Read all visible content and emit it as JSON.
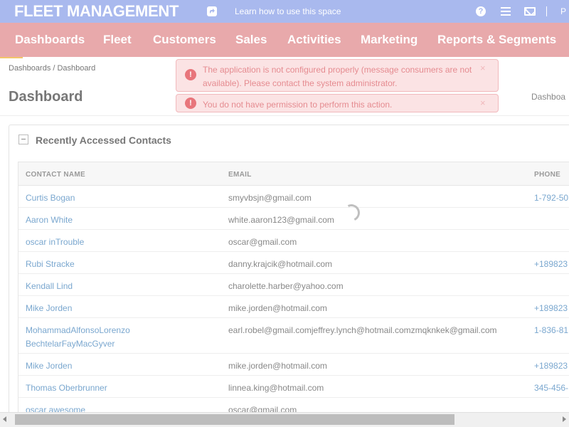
{
  "topbar": {
    "brand": "FLEET MANAGEMENT",
    "learn_link": "Learn how to use this space",
    "help_glyph": "?",
    "user_initial": "P"
  },
  "nav": {
    "items": [
      "Dashboards",
      "Fleet",
      "Customers",
      "Sales",
      "Activities",
      "Marketing",
      "Reports & Segments"
    ]
  },
  "breadcrumb": "Dashboards / Dashboard",
  "page_title": "Dashboard",
  "right_crumb": "Dashboa",
  "alerts": [
    {
      "icon": "!",
      "text": "The application is not configured properly (message consumers are not available). Please contact the system administrator.",
      "close": "×"
    },
    {
      "icon": "!",
      "text": "You do not have permission to perform this action.",
      "close": "×"
    }
  ],
  "widget": {
    "title": "Recently Accessed Contacts",
    "columns": [
      "CONTACT NAME",
      "EMAIL",
      "PHONE"
    ],
    "rows": [
      {
        "name": "Curtis Bogan",
        "email": "smyvbsjn@gmail.com",
        "phone": "1-792-50"
      },
      {
        "name": "Aaron White",
        "email": "white.aaron123@gmail.com",
        "phone": ""
      },
      {
        "name": "oscar inTrouble",
        "email": "oscar@gmail.com",
        "phone": ""
      },
      {
        "name": "Rubi Stracke",
        "email": "danny.krajcik@hotmail.com",
        "phone": "+189823"
      },
      {
        "name": "Kendall Lind",
        "email": "charolette.harber@yahoo.com",
        "phone": ""
      },
      {
        "name": "Mike Jorden",
        "email": "mike.jorden@hotmail.com",
        "phone": "+189823"
      },
      {
        "name": "MohammadAlfonsoLorenzo",
        "name_line2": "BechtelarFayMacGyver",
        "email": "earl.robel@gmail.comjeffrey.lynch@hotmail.comzmqknkek@gmail.com",
        "phone": "1-836-81"
      },
      {
        "name": "Mike Jorden",
        "email": "mike.jorden@hotmail.com",
        "phone": "+189823"
      },
      {
        "name": "Thomas Oberbrunner",
        "email": "linnea.king@hotmail.com",
        "phone": "345-456-"
      },
      {
        "name": "oscar awesome",
        "email": "oscar@gmail.com",
        "phone": ""
      }
    ]
  },
  "colors": {
    "topbar": "#a9b9ee",
    "navbar": "#e8a9ab",
    "alert_bg": "#fbe3e4",
    "link": "#7aa7cf"
  }
}
